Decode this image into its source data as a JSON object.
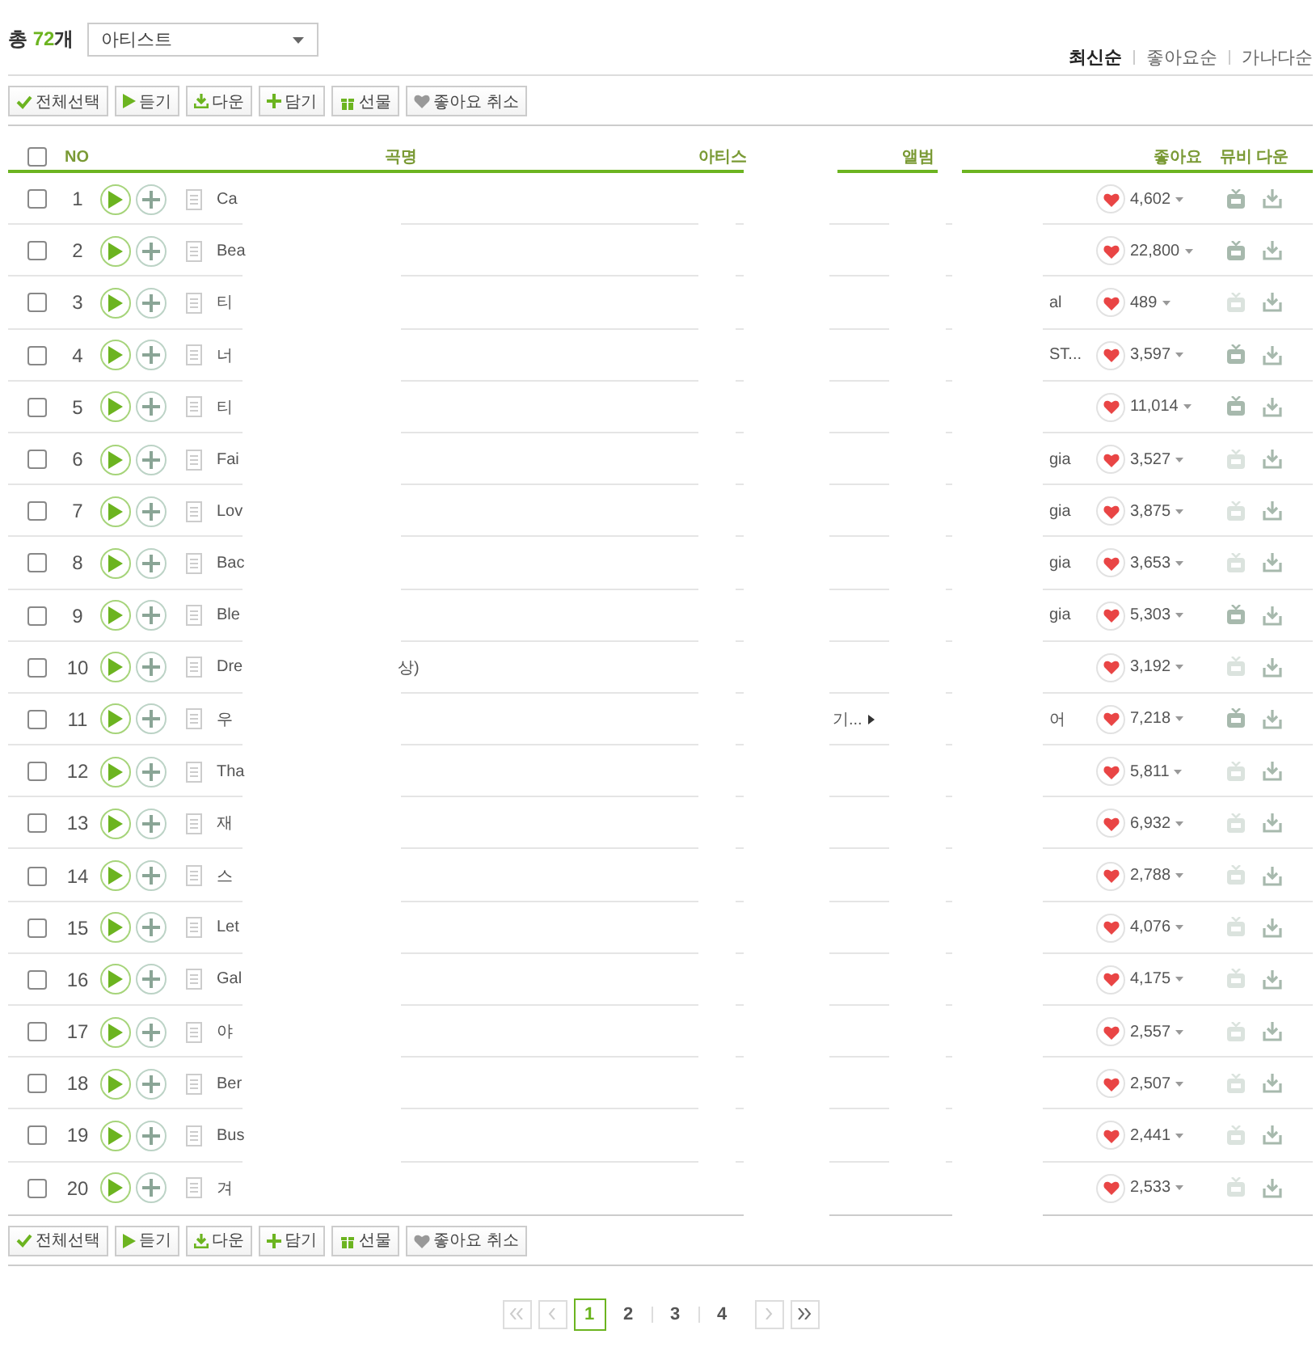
{
  "summary": {
    "label": "총",
    "count": "72",
    "unit": "개"
  },
  "filter": {
    "value": "아티스트"
  },
  "sort": [
    {
      "label": "최신순",
      "selected": true
    },
    {
      "label": "좋아요순",
      "selected": false
    },
    {
      "label": "가나다순",
      "selected": false
    }
  ],
  "toolbar": [
    {
      "kind": "check",
      "label": "전체선택"
    },
    {
      "kind": "play",
      "label": "듣기"
    },
    {
      "kind": "download",
      "label": "다운"
    },
    {
      "kind": "add",
      "label": "담기"
    },
    {
      "kind": "gift",
      "label": "선물"
    },
    {
      "kind": "heart",
      "label": "좋아요 취소"
    }
  ],
  "columns": {
    "checked": false,
    "no": "NO",
    "title": "곡명",
    "artist": "아티스",
    "album": "앨범",
    "likes": "좋아요",
    "mv": "뮤비",
    "download": "다운"
  },
  "rows": [
    {
      "no": "1",
      "checked": false,
      "title": "Ca",
      "likes": "4,602",
      "mv": true
    },
    {
      "no": "2",
      "checked": false,
      "title": "Bea",
      "likes": "22,800",
      "mv": true
    },
    {
      "no": "3",
      "checked": false,
      "title": "티",
      "album": "al",
      "likes": "489",
      "mv": false
    },
    {
      "no": "4",
      "checked": false,
      "title": "너",
      "album": "ST...",
      "likes": "3,597",
      "mv": true
    },
    {
      "no": "5",
      "checked": false,
      "title": "티",
      "likes": "11,014",
      "mv": true
    },
    {
      "no": "6",
      "checked": false,
      "title": "Fai",
      "album": "gia",
      "likes": "3,527",
      "mv": false
    },
    {
      "no": "7",
      "checked": false,
      "title": "Lov",
      "album": "gia",
      "likes": "3,875",
      "mv": false
    },
    {
      "no": "8",
      "checked": false,
      "title": "Bac",
      "album": "gia",
      "likes": "3,653",
      "mv": false
    },
    {
      "no": "9",
      "checked": false,
      "title": "Ble",
      "album": "gia",
      "likes": "5,303",
      "mv": true
    },
    {
      "no": "10",
      "checked": false,
      "title": "Dre",
      "title_tail": "상)",
      "likes": "3,192",
      "mv": false
    },
    {
      "no": "11",
      "checked": false,
      "title": "우",
      "artist": "기...",
      "album": "어",
      "likes": "7,218",
      "mv": true
    },
    {
      "no": "12",
      "checked": false,
      "title": "Tha",
      "likes": "5,811",
      "mv": false
    },
    {
      "no": "13",
      "checked": false,
      "title": "재",
      "likes": "6,932",
      "mv": false
    },
    {
      "no": "14",
      "checked": false,
      "title": "스",
      "likes": "2,788",
      "mv": false
    },
    {
      "no": "15",
      "checked": false,
      "title": "Let",
      "likes": "4,076",
      "mv": false
    },
    {
      "no": "16",
      "checked": false,
      "title": "Gal",
      "likes": "4,175",
      "mv": false
    },
    {
      "no": "17",
      "checked": false,
      "title": "야",
      "likes": "2,557",
      "mv": false
    },
    {
      "no": "18",
      "checked": false,
      "title": "Ber",
      "likes": "2,507",
      "mv": false
    },
    {
      "no": "19",
      "checked": false,
      "title": "Bus",
      "likes": "2,441",
      "mv": false
    },
    {
      "no": "20",
      "checked": false,
      "title": "겨",
      "likes": "2,533",
      "mv": false
    }
  ],
  "bottom_toolbar": [
    {
      "kind": "check",
      "label": "전체선택"
    },
    {
      "kind": "play",
      "label": "듣기"
    },
    {
      "kind": "download",
      "label": "다운"
    },
    {
      "kind": "add",
      "label": "담기"
    },
    {
      "kind": "gift",
      "label": "선물"
    },
    {
      "kind": "heart",
      "label": "좋아요 취소"
    }
  ],
  "pagination": {
    "pages": [
      {
        "label": "1",
        "selected": true
      },
      {
        "label": "2",
        "selected": false
      },
      {
        "label": "3",
        "selected": false
      },
      {
        "label": "4",
        "selected": false
      }
    ]
  }
}
